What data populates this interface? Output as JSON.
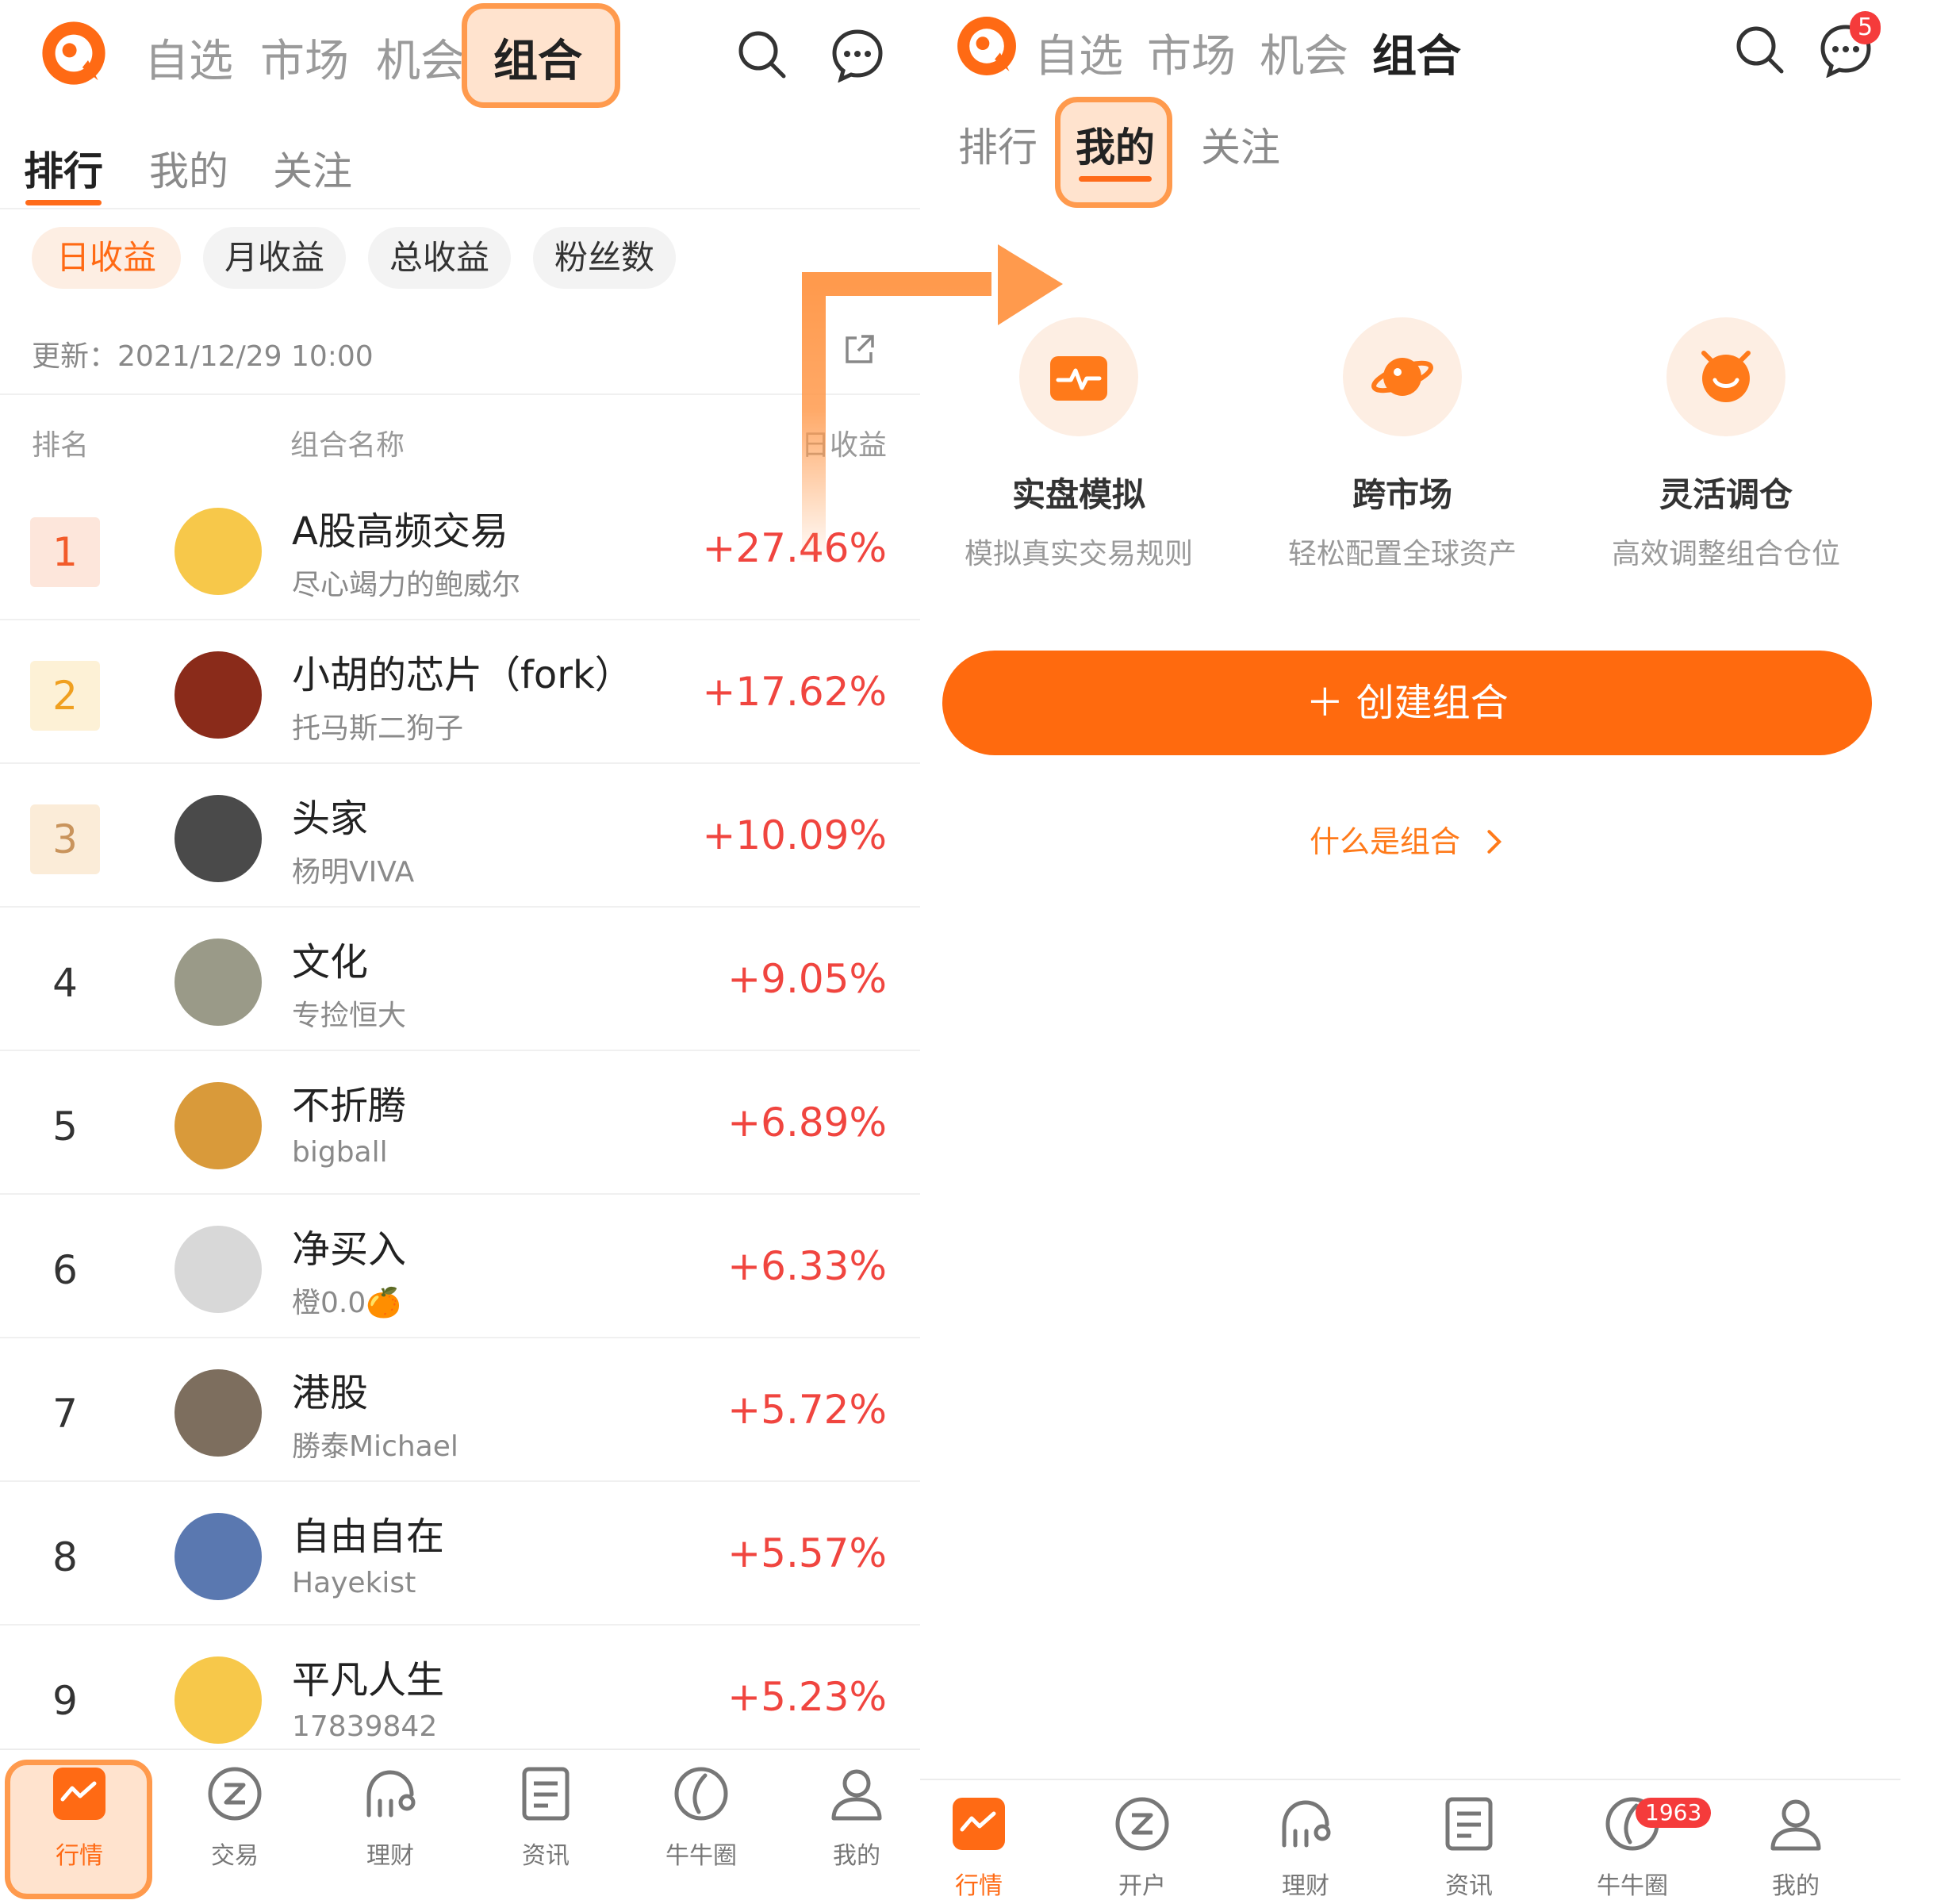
{
  "colors": {
    "accent": "#ff6a14",
    "positive": "#f0453f",
    "highlight": "#ff9a4d"
  },
  "left": {
    "nav_tabs": [
      "自选",
      "市场",
      "机会",
      "组合"
    ],
    "sub_tabs": [
      "排行",
      "我的",
      "关注"
    ],
    "chips": [
      "日收益",
      "月收益",
      "总收益",
      "粉丝数"
    ],
    "update_label": "更新：",
    "update_time": "2021/12/29 10:00",
    "col_rank": "排名",
    "col_name": "组合名称",
    "col_return": "日收益",
    "rows": [
      {
        "rank": "1",
        "name": "A股高频交易",
        "author": "尽心竭力的鲍威尔",
        "ret": "+27.46%"
      },
      {
        "rank": "2",
        "name": "小胡的芯片（fork）",
        "author": "托马斯二狗子",
        "ret": "+17.62%"
      },
      {
        "rank": "3",
        "name": "头家",
        "author": "杨明VIVA",
        "ret": "+10.09%"
      },
      {
        "rank": "4",
        "name": "文化",
        "author": "专捡恒大",
        "ret": "+9.05%"
      },
      {
        "rank": "5",
        "name": "不折腾",
        "author": "bigball",
        "ret": "+6.89%"
      },
      {
        "rank": "6",
        "name": "净买入",
        "author": "橙0.0🍊",
        "ret": "+6.33%"
      },
      {
        "rank": "7",
        "name": "港股",
        "author": "勝泰Michael",
        "ret": "+5.72%"
      },
      {
        "rank": "8",
        "name": "自由自在",
        "author": "Hayekist",
        "ret": "+5.57%"
      },
      {
        "rank": "9",
        "name": "平凡人生",
        "author": "17839842",
        "ret": "+5.23%"
      }
    ],
    "bottom_tabs": [
      "行情",
      "交易",
      "理财",
      "资讯",
      "牛牛圈",
      "我的"
    ]
  },
  "right": {
    "nav_tabs": [
      "自选",
      "市场",
      "机会",
      "组合"
    ],
    "message_badge": "5",
    "sub_tabs": [
      "排行",
      "我的",
      "关注"
    ],
    "features": [
      {
        "title": "实盘模拟",
        "sub": "模拟真实交易规则",
        "icon": "pulse-icon"
      },
      {
        "title": "跨市场",
        "sub": "轻松配置全球资产",
        "icon": "planet-icon"
      },
      {
        "title": "灵活调仓",
        "sub": "高效调整组合仓位",
        "icon": "refresh-smile-icon"
      }
    ],
    "create_button": "＋  创建组合",
    "what_is": "什么是组合",
    "bottom_tabs": [
      "行情",
      "开户",
      "理财",
      "资讯",
      "牛牛圈",
      "我的"
    ],
    "community_badge": "1963"
  }
}
